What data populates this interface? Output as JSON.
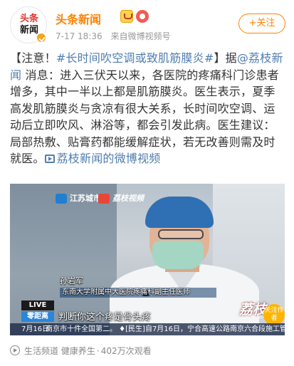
{
  "header": {
    "avatar_line1": "头条",
    "avatar_line2": "新闻",
    "user_name": "头条新闻",
    "time": "7-17 18:36",
    "source": "来自微博视频号",
    "follow_label": "+关注",
    "badges": [
      "vip-crown-icon",
      "medal-icon"
    ],
    "verified_color": "#f7a31c"
  },
  "post": {
    "text_intro": "【注意！",
    "hashtag": "#长时间吹空调或致肌筋膜炎#",
    "text_mid": "】据",
    "mention": "@荔枝新闻",
    "body": " 消息：进入三伏天以来，各医院的疼痛科门诊患者增多，其中一半以上都是肌筋膜炎。医生表示，夏季高发肌筋膜炎与贪凉有很大关系，长时间吹空调、运动后立即吹风、淋浴等，都会引发此病。医生建议：局部热敷、贴膏药都能缓解症状，若无改善则需及时就医。",
    "video_link": "荔枝新闻的微博视频"
  },
  "video": {
    "logo_js": "江苏城市",
    "logo_lz": "荔枝视频",
    "name": "孙岩军",
    "role": "东南大学附属中大医院疼痛科副主任医师",
    "live": "LIVE",
    "channel": "零距离",
    "subtitle": "判断你这个疼是骨头疼",
    "ticker_date": "7月16日",
    "ticker_text": "南京市十件全国第二。 ♦[民生]自7月16日，宁合高速公路南京六合段施工管制",
    "watermark": "荔枝",
    "watermark_sub": "LITCHI NEWS",
    "follow_circle": "关注作者"
  },
  "footer": {
    "channel": "生活频道",
    "category": "健康养生",
    "separator": "·",
    "views": "402万次观看"
  },
  "colors": {
    "accent": "#ff8200",
    "link": "#507daf",
    "meta": "#999999"
  }
}
